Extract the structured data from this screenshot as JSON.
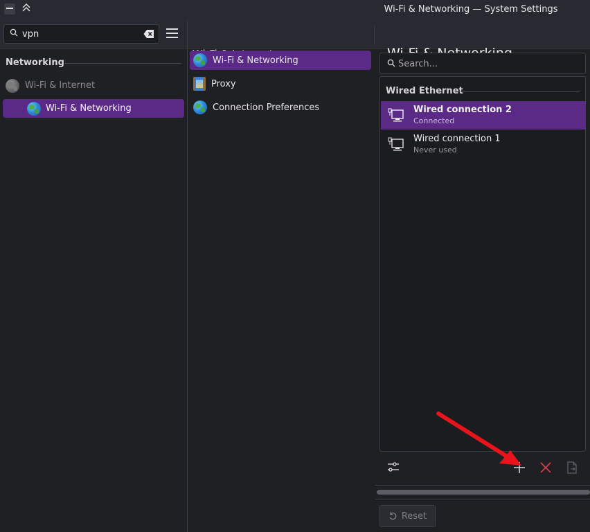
{
  "window": {
    "title": "Wi-Fi & Networking — System Settings"
  },
  "sidebar": {
    "search_value": "vpn",
    "section_heading": "Networking",
    "items": [
      {
        "label": "Wi-Fi & Internet",
        "icon": "globe-icon",
        "state": "dimmed"
      },
      {
        "label": "Wi-Fi & Networking",
        "icon": "globe-icon",
        "state": "selected"
      }
    ]
  },
  "middle": {
    "header": "Wi-Fi & Internet",
    "items": [
      {
        "label": "Wi-Fi & Networking",
        "icon": "globe-icon",
        "selected": true
      },
      {
        "label": "Proxy",
        "icon": "proxy-icon",
        "selected": false
      },
      {
        "label": "Connection Preferences",
        "icon": "globe-icon",
        "selected": false
      }
    ]
  },
  "right": {
    "header": "Wi-Fi & Networking",
    "search_placeholder": "Search...",
    "group_heading": "Wired Ethernet",
    "connections": [
      {
        "name": "Wired connection 2",
        "status": "Connected",
        "selected": true
      },
      {
        "name": "Wired connection 1",
        "status": "Never used",
        "selected": false
      }
    ],
    "toolbar": {
      "configure_icon": "sliders-icon",
      "add_icon": "plus-icon",
      "remove_icon": "close-icon",
      "export_icon": "export-icon"
    },
    "reset_label": "Reset"
  },
  "colors": {
    "accent": "#5b2a86",
    "background": "#1f2024",
    "annotation_arrow": "#e8141b",
    "remove_icon": "#d9404a"
  }
}
